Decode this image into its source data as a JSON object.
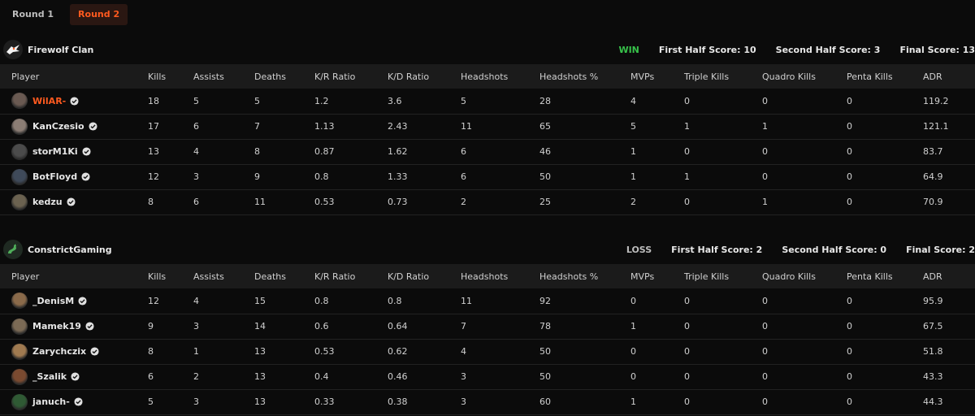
{
  "tabs": [
    {
      "label": "Round 1",
      "active": false
    },
    {
      "label": "Round 2",
      "active": true
    }
  ],
  "columns": [
    "Player",
    "Kills",
    "Assists",
    "Deaths",
    "K/R Ratio",
    "K/D Ratio",
    "Headshots",
    "Headshots %",
    "MVPs",
    "Triple Kills",
    "Quadro Kills",
    "Penta Kills",
    "ADR"
  ],
  "teams": [
    {
      "name": "Firewolf Clan",
      "result": "WIN",
      "first_half": "First Half Score: 10",
      "second_half": "Second Half Score: 3",
      "final": "Final Score: 13",
      "players": [
        {
          "name": "WilAR-",
          "highlight": true,
          "stats": [
            "18",
            "5",
            "5",
            "1.2",
            "3.6",
            "5",
            "28",
            "4",
            "0",
            "0",
            "0",
            "119.2"
          ]
        },
        {
          "name": "KanCzesio",
          "stats": [
            "17",
            "6",
            "7",
            "1.13",
            "2.43",
            "11",
            "65",
            "5",
            "1",
            "1",
            "0",
            "121.1"
          ]
        },
        {
          "name": "storM1Ki",
          "stats": [
            "13",
            "4",
            "8",
            "0.87",
            "1.62",
            "6",
            "46",
            "1",
            "0",
            "0",
            "0",
            "83.7"
          ]
        },
        {
          "name": "BotFloyd",
          "stats": [
            "12",
            "3",
            "9",
            "0.8",
            "1.33",
            "6",
            "50",
            "1",
            "1",
            "0",
            "0",
            "64.9"
          ]
        },
        {
          "name": "kedzu",
          "stats": [
            "8",
            "6",
            "11",
            "0.53",
            "0.73",
            "2",
            "25",
            "2",
            "0",
            "1",
            "0",
            "70.9"
          ]
        }
      ]
    },
    {
      "name": "ConstrictGaming",
      "result": "LOSS",
      "first_half": "First Half Score: 2",
      "second_half": "Second Half Score: 0",
      "final": "Final Score: 2",
      "players": [
        {
          "name": "_DenisM",
          "stats": [
            "12",
            "4",
            "15",
            "0.8",
            "0.8",
            "11",
            "92",
            "0",
            "0",
            "0",
            "0",
            "95.9"
          ]
        },
        {
          "name": "Mamek19",
          "stats": [
            "9",
            "3",
            "14",
            "0.6",
            "0.64",
            "7",
            "78",
            "1",
            "0",
            "0",
            "0",
            "67.5"
          ]
        },
        {
          "name": "Zarychczix",
          "stats": [
            "8",
            "1",
            "13",
            "0.53",
            "0.62",
            "4",
            "50",
            "0",
            "0",
            "0",
            "0",
            "51.8"
          ]
        },
        {
          "name": "_Szalik",
          "stats": [
            "6",
            "2",
            "13",
            "0.4",
            "0.46",
            "3",
            "50",
            "0",
            "0",
            "0",
            "0",
            "43.3"
          ]
        },
        {
          "name": "januch-",
          "stats": [
            "5",
            "3",
            "13",
            "0.33",
            "0.38",
            "3",
            "60",
            "1",
            "0",
            "0",
            "0",
            "44.3"
          ]
        }
      ]
    }
  ],
  "colors": {
    "accent": "#ff5a1f",
    "win": "#37c24a",
    "header_bg": "#1b1b1b",
    "page_bg": "#0b0b0b"
  },
  "icons": {
    "verified": "verified-check-icon",
    "team1_logo": "firewolf-logo-icon",
    "team2_logo": "snake-logo-icon"
  }
}
